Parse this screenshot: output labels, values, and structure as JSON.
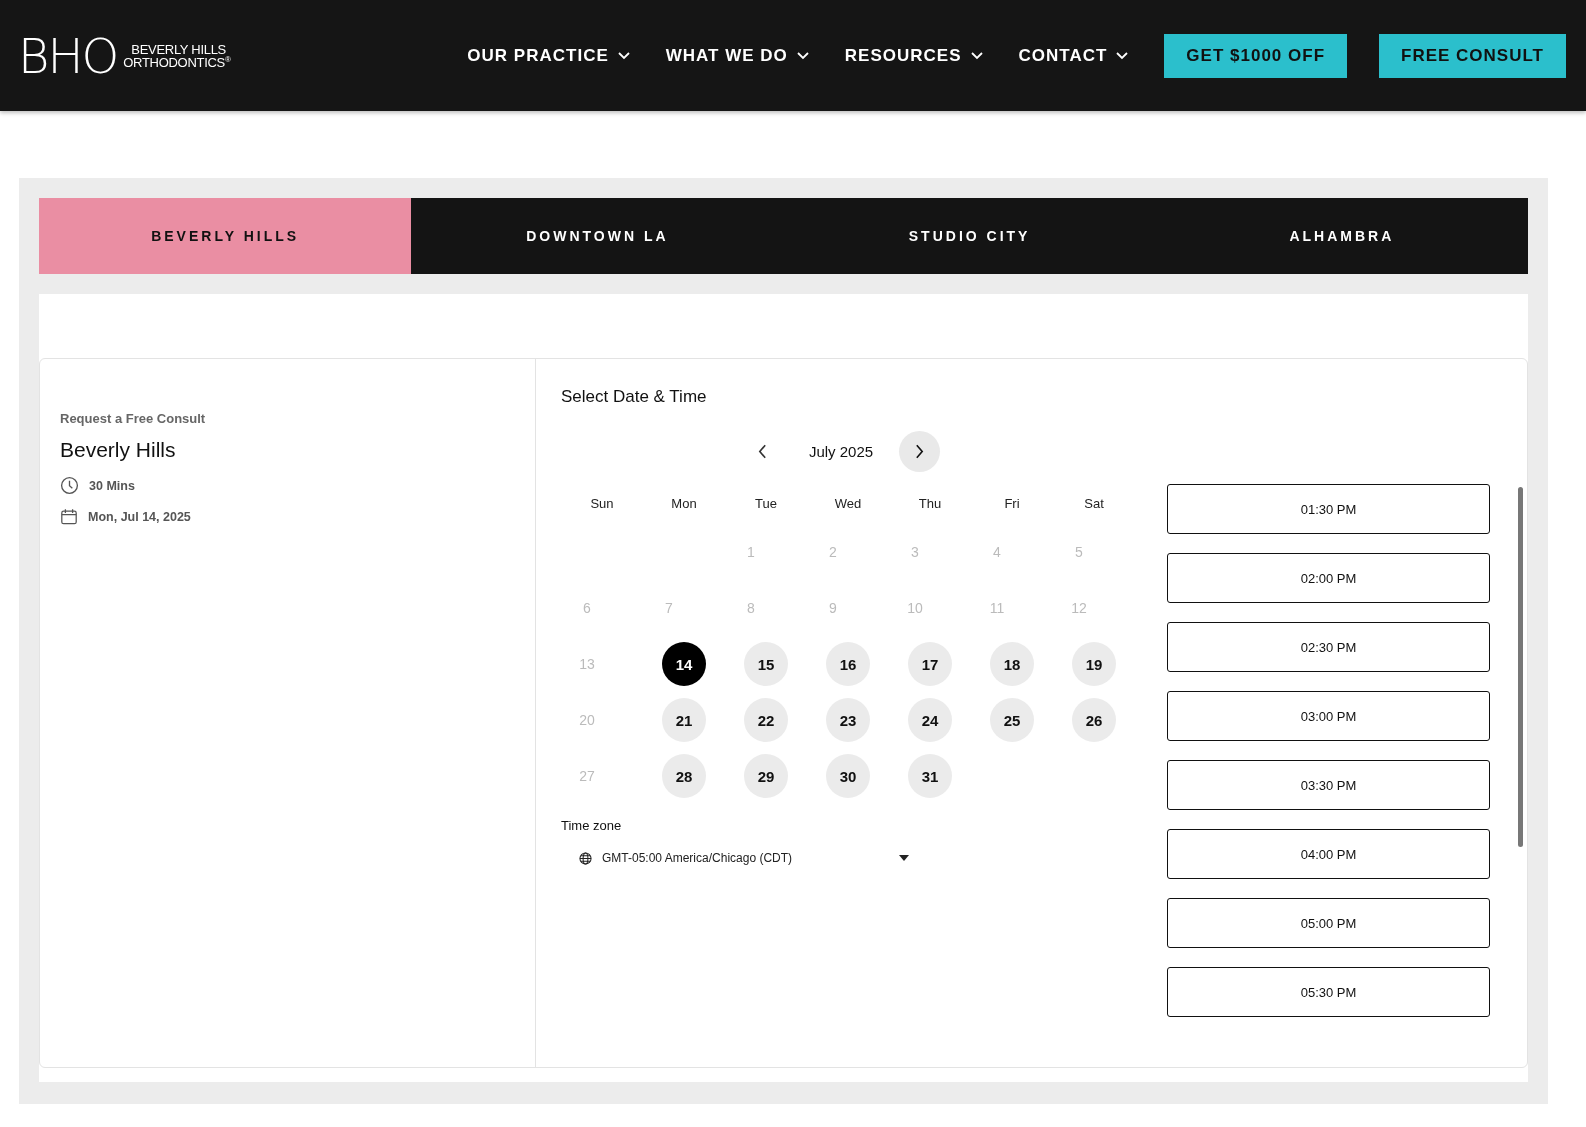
{
  "header": {
    "logo": {
      "mark": "BHO",
      "line_1": "BEVERLY HILLS",
      "line_2": "ORTHODONTICS",
      "registered": "®"
    },
    "nav": [
      {
        "label": "OUR PRACTICE",
        "has_menu": true
      },
      {
        "label": "WHAT WE DO",
        "has_menu": true
      },
      {
        "label": "RESOURCES",
        "has_menu": true
      },
      {
        "label": "CONTACT",
        "has_menu": true
      }
    ],
    "buttons": [
      "GET $1000 OFF",
      "FREE CONSULT"
    ]
  },
  "location_tabs": [
    {
      "label": "BEVERLY HILLS",
      "selected": true
    },
    {
      "label": "DOWNTOWN LA",
      "selected": false
    },
    {
      "label": "STUDIO CITY",
      "selected": false
    },
    {
      "label": "ALHAMBRA",
      "selected": false
    }
  ],
  "details": {
    "eyebrow": "Request a Free Consult",
    "title": "Beverly Hills",
    "duration": "30 Mins",
    "date": "Mon, Jul 14, 2025"
  },
  "scheduler": {
    "heading": "Select Date & Time",
    "month": "July 2025",
    "weekdays": [
      "Sun",
      "Mon",
      "Tue",
      "Wed",
      "Thu",
      "Fri",
      "Sat"
    ],
    "weeks": [
      [
        {
          "kind": "blank"
        },
        {
          "kind": "blank"
        },
        {
          "kind": "unavailable",
          "day": "1",
          "selected": false
        },
        {
          "kind": "unavailable",
          "day": "2",
          "selected": false
        },
        {
          "kind": "unavailable",
          "day": "3",
          "selected": false
        },
        {
          "kind": "unavailable",
          "day": "4",
          "selected": false
        },
        {
          "kind": "unavailable",
          "day": "5",
          "selected": false
        }
      ],
      [
        {
          "kind": "unavailable",
          "day": "6",
          "selected": false
        },
        {
          "kind": "unavailable",
          "day": "7",
          "selected": false
        },
        {
          "kind": "unavailable",
          "day": "8",
          "selected": false
        },
        {
          "kind": "unavailable",
          "day": "9",
          "selected": false
        },
        {
          "kind": "unavailable",
          "day": "10",
          "selected": false
        },
        {
          "kind": "unavailable",
          "day": "11",
          "selected": false
        },
        {
          "kind": "unavailable",
          "day": "12",
          "selected": false
        }
      ],
      [
        {
          "kind": "unavailable",
          "day": "13",
          "selected": false
        },
        {
          "kind": "available",
          "day": "14",
          "selected": true
        },
        {
          "kind": "available",
          "day": "15",
          "selected": false
        },
        {
          "kind": "available",
          "day": "16",
          "selected": false
        },
        {
          "kind": "available",
          "day": "17",
          "selected": false
        },
        {
          "kind": "available",
          "day": "18",
          "selected": false
        },
        {
          "kind": "available",
          "day": "19",
          "selected": false
        }
      ],
      [
        {
          "kind": "unavailable",
          "day": "20",
          "selected": false
        },
        {
          "kind": "available",
          "day": "21",
          "selected": false
        },
        {
          "kind": "available",
          "day": "22",
          "selected": false
        },
        {
          "kind": "available",
          "day": "23",
          "selected": false
        },
        {
          "kind": "available",
          "day": "24",
          "selected": false
        },
        {
          "kind": "available",
          "day": "25",
          "selected": false
        },
        {
          "kind": "available",
          "day": "26",
          "selected": false
        }
      ],
      [
        {
          "kind": "unavailable",
          "day": "27",
          "selected": false
        },
        {
          "kind": "available",
          "day": "28",
          "selected": false
        },
        {
          "kind": "available",
          "day": "29",
          "selected": false
        },
        {
          "kind": "available",
          "day": "30",
          "selected": false
        },
        {
          "kind": "available",
          "day": "31",
          "selected": false
        },
        {
          "kind": "blank"
        },
        {
          "kind": "blank"
        }
      ]
    ],
    "timezone_label": "Time zone",
    "timezone": "GMT-05:00 America/Chicago (CDT)",
    "time_slots": [
      "01:30 PM",
      "02:00 PM",
      "02:30 PM",
      "03:00 PM",
      "03:30 PM",
      "04:00 PM",
      "05:00 PM",
      "05:30 PM"
    ]
  }
}
